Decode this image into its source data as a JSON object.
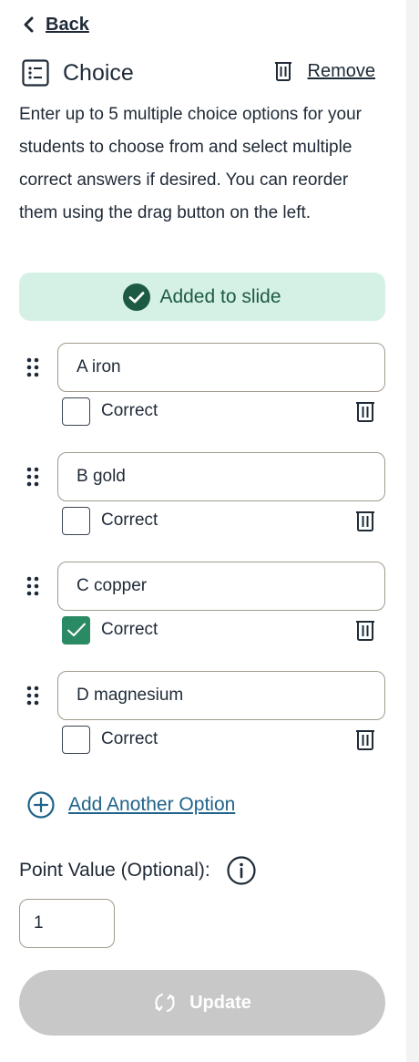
{
  "nav": {
    "back_label": "Back"
  },
  "header": {
    "title": "Choice",
    "remove_label": "Remove"
  },
  "description": "Enter up to 5 multiple choice options for your students to choose from and select multiple correct answers if desired. You can reorder them using the drag button on the left.",
  "status": {
    "added_label": "Added to slide"
  },
  "options": [
    {
      "value": "A iron",
      "correct_label": "Correct",
      "checked": false
    },
    {
      "value": "B gold",
      "correct_label": "Correct",
      "checked": false
    },
    {
      "value": "C copper",
      "correct_label": "Correct",
      "checked": true
    },
    {
      "value": "D magnesium",
      "correct_label": "Correct",
      "checked": false
    }
  ],
  "add_option_label": "Add Another Option",
  "point_value": {
    "label": "Point Value (Optional):",
    "value": "1"
  },
  "update_label": "Update",
  "colors": {
    "added_bg": "#d5f1e5",
    "added_text": "#1d5a44",
    "checked": "#2a8a63",
    "link": "#20638a",
    "update_bg": "#c8c8c8"
  },
  "icons": {
    "back": "chevron-left-icon",
    "header": "list-icon",
    "remove": "trash-icon",
    "added": "check-circle-icon",
    "drag": "drag-handle-icon",
    "add": "plus-circle-icon",
    "info": "info-icon",
    "update": "refresh-icon"
  }
}
